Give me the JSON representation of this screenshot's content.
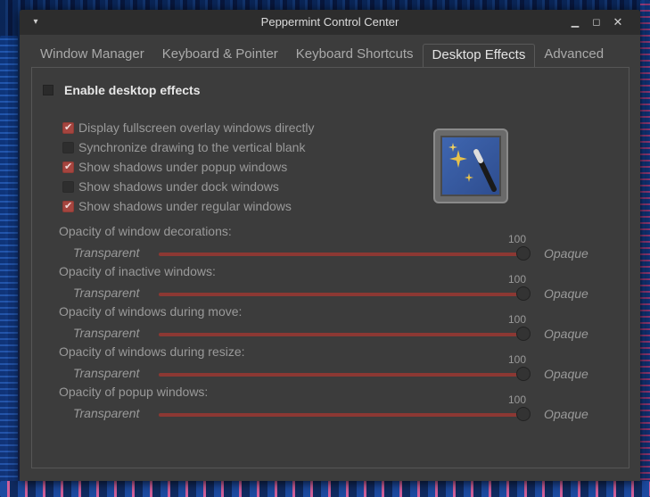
{
  "window": {
    "title": "Peppermint Control Center",
    "menu_icon": "chevron-down-icon",
    "controls": [
      "minimize-icon",
      "maximize-icon",
      "close-icon"
    ]
  },
  "tabs": [
    {
      "label": "Window Manager",
      "active": false
    },
    {
      "label": "Keyboard & Pointer",
      "active": false
    },
    {
      "label": "Keyboard Shortcuts",
      "active": false
    },
    {
      "label": "Desktop Effects",
      "active": true
    },
    {
      "label": "Advanced",
      "active": false
    }
  ],
  "effects": {
    "enable_label": "Enable desktop effects",
    "enable_checked": false,
    "options": [
      {
        "label": "Display fullscreen overlay windows directly",
        "checked": true
      },
      {
        "label": "Synchronize drawing to the vertical blank",
        "checked": false
      },
      {
        "label": "Show shadows under popup windows",
        "checked": true
      },
      {
        "label": "Show shadows under dock windows",
        "checked": false
      },
      {
        "label": "Show shadows under regular windows",
        "checked": true
      }
    ],
    "icon": "magic-wand-icon"
  },
  "opacity": {
    "min_label": "Transparent",
    "max_label": "Opaque",
    "sliders": [
      {
        "label": "Opacity of window decorations:",
        "value": "100"
      },
      {
        "label": "Opacity of inactive windows:",
        "value": "100"
      },
      {
        "label": "Opacity of windows during move:",
        "value": "100"
      },
      {
        "label": "Opacity of windows during resize:",
        "value": "100"
      },
      {
        "label": "Opacity of popup windows:",
        "value": "100"
      }
    ]
  },
  "colors": {
    "accent": "#a5453f",
    "track": "#8c3833",
    "window_bg": "#3c3c3c"
  }
}
